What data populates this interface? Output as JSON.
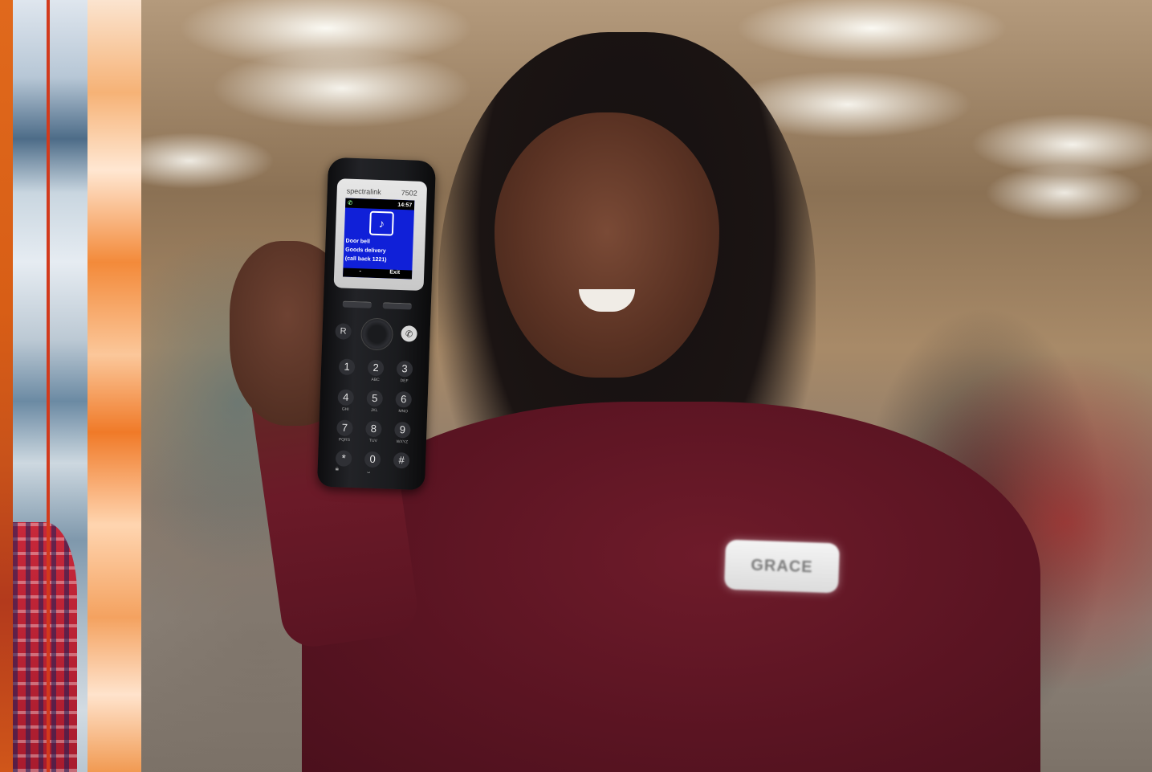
{
  "phone": {
    "brand": "spectralink",
    "model": "7502",
    "time": "14:57",
    "message_lines": [
      "Door bell",
      "Goods delivery",
      "(call back 1221)"
    ],
    "softkey_left": "-",
    "softkey_right": "Exit",
    "side_left": "R",
    "keys": [
      {
        "num": "1",
        "sub": ""
      },
      {
        "num": "2",
        "sub": "ABC"
      },
      {
        "num": "3",
        "sub": "DEF"
      },
      {
        "num": "4",
        "sub": "GHI"
      },
      {
        "num": "5",
        "sub": "JKL"
      },
      {
        "num": "6",
        "sub": "MNO"
      },
      {
        "num": "7",
        "sub": "PQRS"
      },
      {
        "num": "8",
        "sub": "TUV"
      },
      {
        "num": "9",
        "sub": "WXYZ"
      },
      {
        "num": "*",
        "sub": ""
      },
      {
        "num": "0",
        "sub": ""
      },
      {
        "num": "#",
        "sub": ""
      }
    ],
    "key_sub_labels_below": [
      "QD",
      "",
      "",
      "",
      "",
      "",
      "",
      "",
      ""
    ]
  },
  "badge": {
    "name": "GRACE"
  },
  "colors": {
    "brand_orange": "#e0691c",
    "accent_red": "#d23a1c",
    "screen_blue": "#1020d8",
    "shirt_maroon": "#6e1b2a"
  }
}
